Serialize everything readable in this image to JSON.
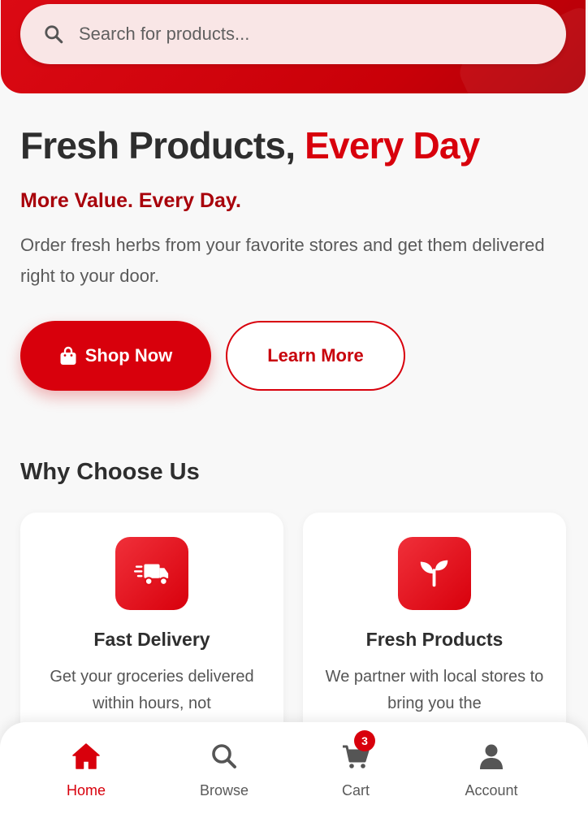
{
  "search": {
    "placeholder": "Search for products..."
  },
  "hero": {
    "title_main": "Fresh Products, ",
    "title_accent": "Every Day",
    "tagline": "More Value. Every Day.",
    "description": "Order fresh herbs from your favorite stores and get them delivered right to your door.",
    "shop_button": "Shop Now",
    "learn_button": "Learn More"
  },
  "why": {
    "title": "Why Choose Us",
    "features": [
      {
        "icon": "truck-icon",
        "title": "Fast Delivery",
        "description": "Get your groceries delivered within hours, not"
      },
      {
        "icon": "seedling-icon",
        "title": "Fresh Products",
        "description": "We partner with local stores to bring you the"
      }
    ]
  },
  "nav": {
    "items": [
      {
        "label": "Home",
        "icon": "home-icon",
        "active": true
      },
      {
        "label": "Browse",
        "icon": "search-icon",
        "active": false
      },
      {
        "label": "Cart",
        "icon": "cart-icon",
        "active": false,
        "badge": "3"
      },
      {
        "label": "Account",
        "icon": "user-icon",
        "active": false
      }
    ]
  },
  "colors": {
    "brand": "#d8000c",
    "brand_dark": "#a8000a",
    "text": "#2e2e2e",
    "muted": "#5a5a5a",
    "background": "#f8f8f8"
  }
}
